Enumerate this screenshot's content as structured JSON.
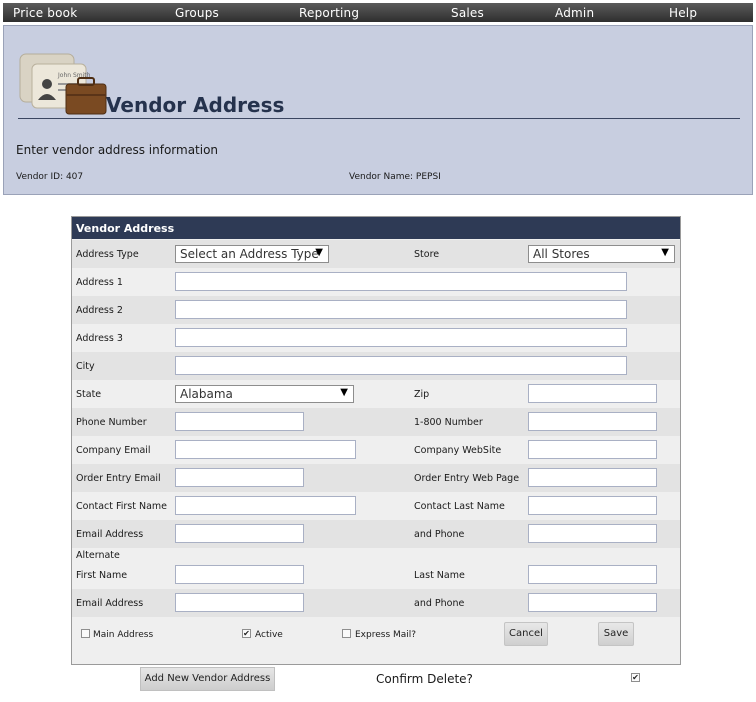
{
  "nav": [
    "Price book",
    "Groups",
    "Reporting",
    "Sales",
    "Admin",
    "Help"
  ],
  "header": {
    "title": "Vendor Address",
    "instructions": "Enter vendor address information",
    "vendor_id": "Vendor ID: 407",
    "vendor_name": "Vendor Name: PEPSI",
    "logo_text": "John Smith"
  },
  "form": {
    "title": "Vendor Address",
    "address_type_label": "Address Type",
    "address_type_value": "Select an Address Type",
    "store_label": "Store",
    "store_value": "All Stores",
    "address1_label": "Address 1",
    "address2_label": "Address 2",
    "address3_label": "Address 3",
    "city_label": "City",
    "state_label": "State",
    "state_value": "Alabama",
    "zip_label": "Zip",
    "phone_label": "Phone Number",
    "phone800_label": "1-800 Number",
    "company_email_label": "Company Email",
    "company_web_label": "Company WebSite",
    "order_email_label": "Order Entry Email",
    "order_web_label": "Order Entry Web Page",
    "contact_first_label": "Contact First Name",
    "contact_last_label": "Contact Last Name",
    "email_label": "Email Address",
    "and_phone_label": "and Phone",
    "alternate_label": "Alternate",
    "alt_first_label": "First Name",
    "alt_last_label": "Last Name",
    "alt_email_label": "Email Address",
    "alt_phone_label": "and Phone",
    "main_address_label": "Main Address",
    "active_label": "Active",
    "express_mail_label": "Express Mail?",
    "cancel_label": "Cancel",
    "save_label": "Save"
  },
  "footer": {
    "add_new_label": "Add New Vendor Address",
    "confirm_delete_label": "Confirm Delete?"
  }
}
